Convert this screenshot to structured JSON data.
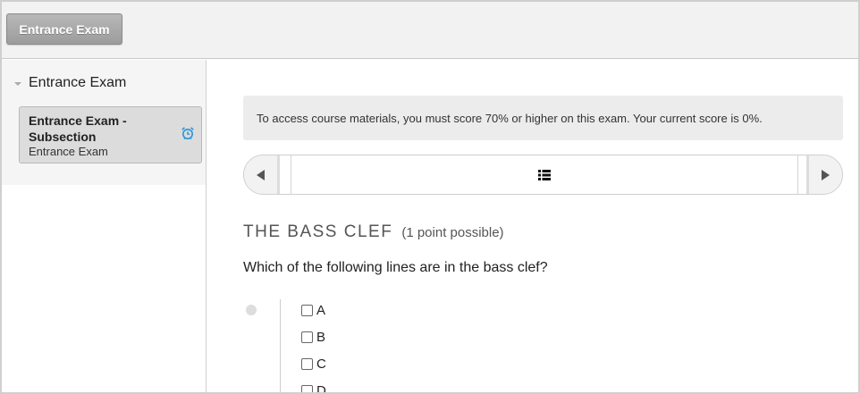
{
  "topbar": {
    "tab_label": "Entrance Exam"
  },
  "sidebar": {
    "chapter_label": "Entrance Exam",
    "subsection": {
      "title": "Entrance Exam - Subsection",
      "subtitle": "Entrance Exam"
    }
  },
  "main": {
    "notice": "To access course materials, you must score 70% or higher on this exam. Your current score is 0%.",
    "problem": {
      "title": "THE BASS CLEF",
      "points": "(1 point possible)",
      "question": "Which of the following lines are in the bass clef?",
      "choices": [
        "A",
        "B",
        "C",
        "D"
      ]
    }
  },
  "icons": {
    "prev": "triangle-left-icon",
    "next": "triangle-right-icon",
    "sequence": "list-icon",
    "timed": "alarm-clock-icon",
    "expand": "caret-down-icon"
  },
  "colors": {
    "accent": "#2b95d6"
  }
}
